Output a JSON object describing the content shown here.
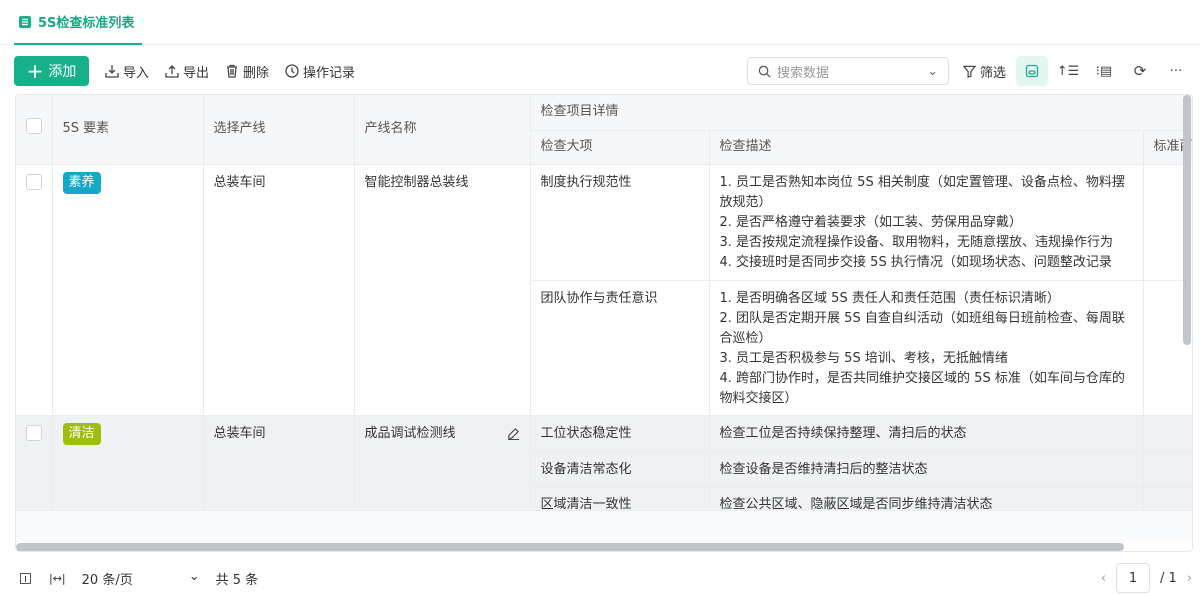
{
  "tab": {
    "title": "5S检查标准列表",
    "icon": "table-list-icon"
  },
  "toolbar": {
    "add": "添加",
    "import": "导入",
    "export": "导出",
    "delete": "删除",
    "history": "操作记录",
    "search_placeholder": "搜索数据",
    "filter": "筛选"
  },
  "colors": {
    "accent": "#16b18b",
    "tag_suyang": "#17a8c9",
    "tag_qingjie": "#9ebd0c"
  },
  "table": {
    "headers": {
      "element": "5S 要素",
      "line_select": "选择产线",
      "line_name": "产线名称",
      "group": "检查项目详情",
      "category": "检查大项",
      "description": "检查描述",
      "standard": "标准酉"
    },
    "rows": [
      {
        "element": "素养",
        "line_select": "总装车间",
        "line_name": "智能控制器总装线",
        "items": [
          {
            "category": "制度执行规范性",
            "description": [
              "1. 员工是否熟知本岗位 5S 相关制度（如定置管理、设备点检、物料摆放规范）",
              "2. 是否严格遵守着装要求（如工装、劳保用品穿戴）",
              "3. 是否按规定流程操作设备、取用物料，无随意摆放、违规操作行为",
              "4. 交接班时是否同步交接 5S 执行情况（如现场状态、问题整改记录"
            ]
          },
          {
            "category": "团队协作与责任意识",
            "description": [
              "1. 是否明确各区域 5S 责任人和责任范围（责任标识清晰）",
              "2. 团队是否定期开展 5S 自查自纠活动（如班组每日班前检查、每周联合巡检）",
              "3. 员工是否积极参与 5S 培训、考核，无抵触情绪",
              "4. 跨部门协作时，是否共同维护交接区域的 5S 标准（如车间与仓库的物料交接区）"
            ]
          }
        ]
      },
      {
        "element": "清洁",
        "line_select": "总装车间",
        "line_name": "成品调试检测线",
        "items": [
          {
            "category": "工位状态稳定性",
            "description": [
              "检查工位是否持续保持整理、清扫后的状态"
            ]
          },
          {
            "category": "设备清洁常态化",
            "description": [
              "检查设备是否维持清扫后的整洁状态"
            ]
          },
          {
            "category": "区域清洁一致性",
            "description": [
              "检查公共区域、隐蔽区域是否同步维持清洁状态"
            ]
          }
        ]
      }
    ]
  },
  "footer": {
    "page_size": "20 条/页",
    "total": "共 5 条",
    "current_page": "1",
    "total_pages": "/ 1"
  }
}
